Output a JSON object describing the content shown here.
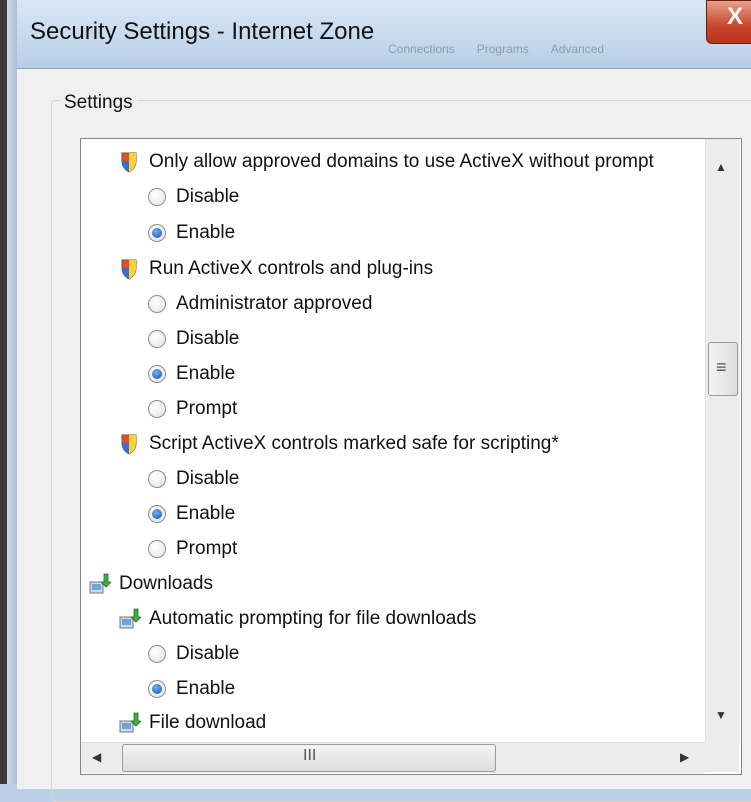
{
  "window": {
    "title": "Security Settings - Internet Zone",
    "close_glyph": "X",
    "background_tabs": [
      "Connections",
      "Programs",
      "Advanced"
    ]
  },
  "group": {
    "label": "Settings"
  },
  "settings": {
    "approved_domains": {
      "label": "Only allow approved domains to use ActiveX without prompt",
      "options": [
        "Disable",
        "Enable"
      ],
      "selected": "Enable"
    },
    "run_activex": {
      "label": "Run ActiveX controls and plug-ins",
      "options": [
        "Administrator approved",
        "Disable",
        "Enable",
        "Prompt"
      ],
      "selected": "Enable"
    },
    "script_activex": {
      "label": "Script ActiveX controls marked safe for scripting*",
      "options": [
        "Disable",
        "Enable",
        "Prompt"
      ],
      "selected": "Enable"
    },
    "downloads": {
      "label": "Downloads"
    },
    "auto_prompting": {
      "label": "Automatic prompting for file downloads",
      "options": [
        "Disable",
        "Enable"
      ],
      "selected": "Enable"
    },
    "file_download": {
      "label": "File download"
    }
  },
  "scrollbars": {
    "up_arrow": "▲",
    "down_arrow": "▼",
    "left_arrow": "◀",
    "right_arrow": "▶",
    "v_grip": "≡",
    "h_grip": "III"
  },
  "colors": {
    "radio_selected": "#0d4fa8",
    "close_button": "#c7452c"
  },
  "icons": {
    "setting": "shield-icon",
    "download": "download-icon"
  }
}
